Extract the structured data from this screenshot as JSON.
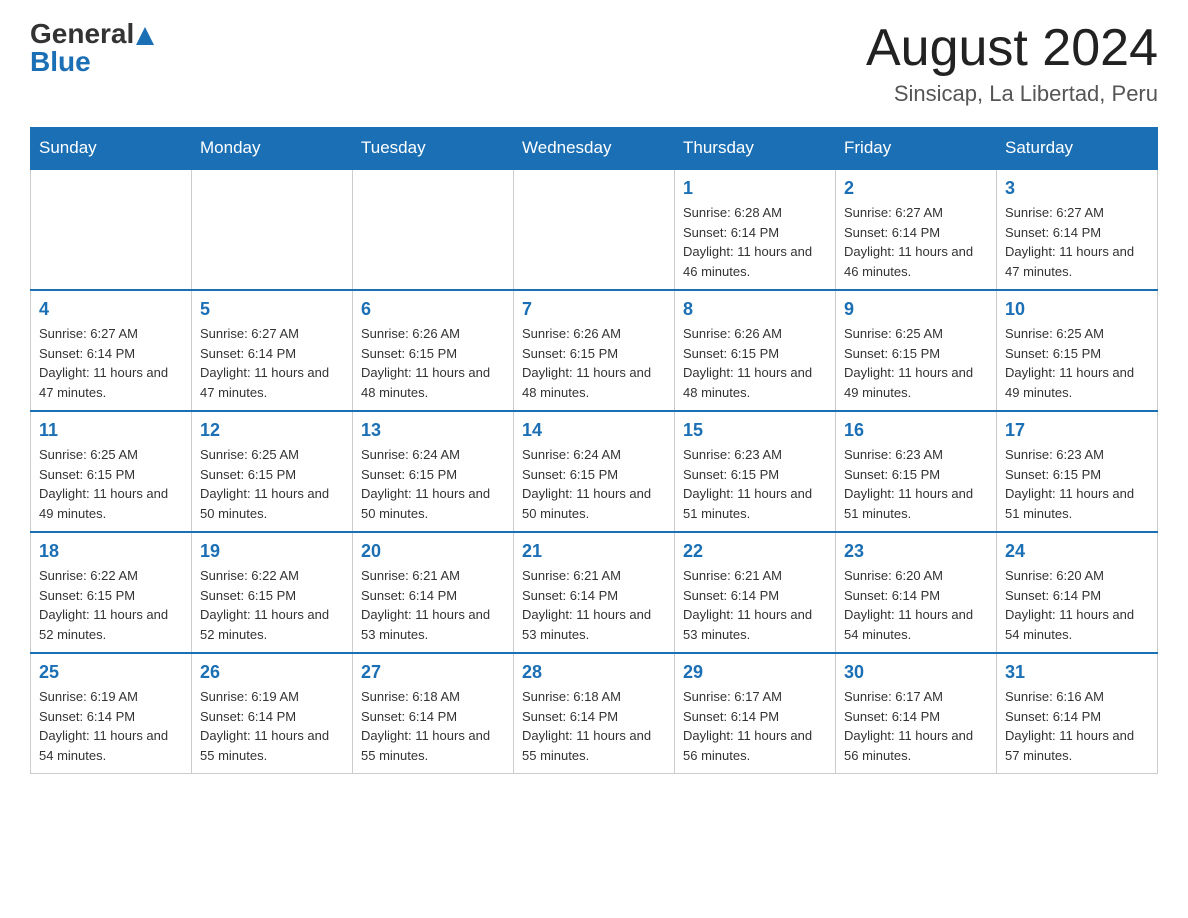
{
  "header": {
    "logo_general": "General",
    "logo_blue": "Blue",
    "month_title": "August 2024",
    "location": "Sinsicap, La Libertad, Peru"
  },
  "weekdays": [
    "Sunday",
    "Monday",
    "Tuesday",
    "Wednesday",
    "Thursday",
    "Friday",
    "Saturday"
  ],
  "weeks": [
    [
      {
        "day": "",
        "info": ""
      },
      {
        "day": "",
        "info": ""
      },
      {
        "day": "",
        "info": ""
      },
      {
        "day": "",
        "info": ""
      },
      {
        "day": "1",
        "info": "Sunrise: 6:28 AM\nSunset: 6:14 PM\nDaylight: 11 hours and 46 minutes."
      },
      {
        "day": "2",
        "info": "Sunrise: 6:27 AM\nSunset: 6:14 PM\nDaylight: 11 hours and 46 minutes."
      },
      {
        "day": "3",
        "info": "Sunrise: 6:27 AM\nSunset: 6:14 PM\nDaylight: 11 hours and 47 minutes."
      }
    ],
    [
      {
        "day": "4",
        "info": "Sunrise: 6:27 AM\nSunset: 6:14 PM\nDaylight: 11 hours and 47 minutes."
      },
      {
        "day": "5",
        "info": "Sunrise: 6:27 AM\nSunset: 6:14 PM\nDaylight: 11 hours and 47 minutes."
      },
      {
        "day": "6",
        "info": "Sunrise: 6:26 AM\nSunset: 6:15 PM\nDaylight: 11 hours and 48 minutes."
      },
      {
        "day": "7",
        "info": "Sunrise: 6:26 AM\nSunset: 6:15 PM\nDaylight: 11 hours and 48 minutes."
      },
      {
        "day": "8",
        "info": "Sunrise: 6:26 AM\nSunset: 6:15 PM\nDaylight: 11 hours and 48 minutes."
      },
      {
        "day": "9",
        "info": "Sunrise: 6:25 AM\nSunset: 6:15 PM\nDaylight: 11 hours and 49 minutes."
      },
      {
        "day": "10",
        "info": "Sunrise: 6:25 AM\nSunset: 6:15 PM\nDaylight: 11 hours and 49 minutes."
      }
    ],
    [
      {
        "day": "11",
        "info": "Sunrise: 6:25 AM\nSunset: 6:15 PM\nDaylight: 11 hours and 49 minutes."
      },
      {
        "day": "12",
        "info": "Sunrise: 6:25 AM\nSunset: 6:15 PM\nDaylight: 11 hours and 50 minutes."
      },
      {
        "day": "13",
        "info": "Sunrise: 6:24 AM\nSunset: 6:15 PM\nDaylight: 11 hours and 50 minutes."
      },
      {
        "day": "14",
        "info": "Sunrise: 6:24 AM\nSunset: 6:15 PM\nDaylight: 11 hours and 50 minutes."
      },
      {
        "day": "15",
        "info": "Sunrise: 6:23 AM\nSunset: 6:15 PM\nDaylight: 11 hours and 51 minutes."
      },
      {
        "day": "16",
        "info": "Sunrise: 6:23 AM\nSunset: 6:15 PM\nDaylight: 11 hours and 51 minutes."
      },
      {
        "day": "17",
        "info": "Sunrise: 6:23 AM\nSunset: 6:15 PM\nDaylight: 11 hours and 51 minutes."
      }
    ],
    [
      {
        "day": "18",
        "info": "Sunrise: 6:22 AM\nSunset: 6:15 PM\nDaylight: 11 hours and 52 minutes."
      },
      {
        "day": "19",
        "info": "Sunrise: 6:22 AM\nSunset: 6:15 PM\nDaylight: 11 hours and 52 minutes."
      },
      {
        "day": "20",
        "info": "Sunrise: 6:21 AM\nSunset: 6:14 PM\nDaylight: 11 hours and 53 minutes."
      },
      {
        "day": "21",
        "info": "Sunrise: 6:21 AM\nSunset: 6:14 PM\nDaylight: 11 hours and 53 minutes."
      },
      {
        "day": "22",
        "info": "Sunrise: 6:21 AM\nSunset: 6:14 PM\nDaylight: 11 hours and 53 minutes."
      },
      {
        "day": "23",
        "info": "Sunrise: 6:20 AM\nSunset: 6:14 PM\nDaylight: 11 hours and 54 minutes."
      },
      {
        "day": "24",
        "info": "Sunrise: 6:20 AM\nSunset: 6:14 PM\nDaylight: 11 hours and 54 minutes."
      }
    ],
    [
      {
        "day": "25",
        "info": "Sunrise: 6:19 AM\nSunset: 6:14 PM\nDaylight: 11 hours and 54 minutes."
      },
      {
        "day": "26",
        "info": "Sunrise: 6:19 AM\nSunset: 6:14 PM\nDaylight: 11 hours and 55 minutes."
      },
      {
        "day": "27",
        "info": "Sunrise: 6:18 AM\nSunset: 6:14 PM\nDaylight: 11 hours and 55 minutes."
      },
      {
        "day": "28",
        "info": "Sunrise: 6:18 AM\nSunset: 6:14 PM\nDaylight: 11 hours and 55 minutes."
      },
      {
        "day": "29",
        "info": "Sunrise: 6:17 AM\nSunset: 6:14 PM\nDaylight: 11 hours and 56 minutes."
      },
      {
        "day": "30",
        "info": "Sunrise: 6:17 AM\nSunset: 6:14 PM\nDaylight: 11 hours and 56 minutes."
      },
      {
        "day": "31",
        "info": "Sunrise: 6:16 AM\nSunset: 6:14 PM\nDaylight: 11 hours and 57 minutes."
      }
    ]
  ]
}
